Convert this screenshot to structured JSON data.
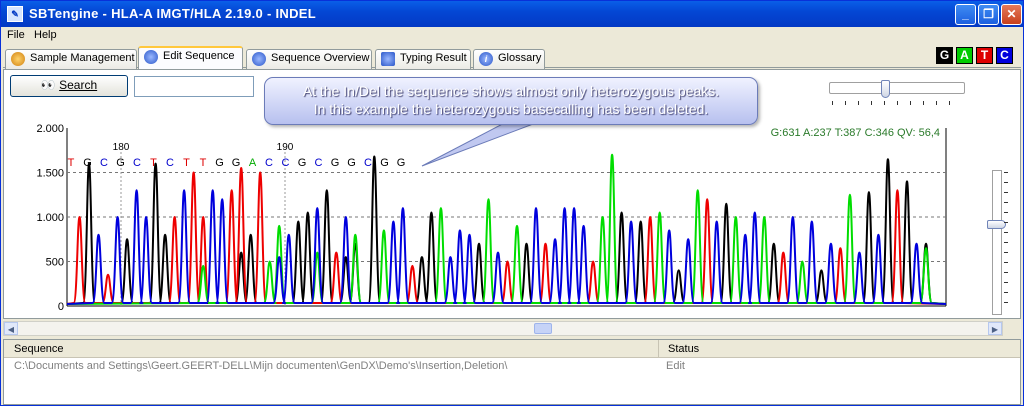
{
  "window": {
    "title": "SBTengine - HLA-A IMGT/HLA 2.19.0 - INDEL"
  },
  "menu": [
    "File",
    "Help"
  ],
  "tabs": [
    {
      "label": "Sample Management",
      "active": false,
      "icon": "sample-icon",
      "color": "#e8a020"
    },
    {
      "label": "Edit Sequence",
      "active": true,
      "icon": "edit-icon",
      "color": "#3060c8"
    },
    {
      "label": "Sequence Overview",
      "active": false,
      "icon": "overview-icon",
      "color": "#3060c8"
    },
    {
      "label": "Typing Result",
      "active": false,
      "icon": "typing-icon",
      "color": "#3060c8"
    },
    {
      "label": "Glossary",
      "active": false,
      "icon": "info-icon",
      "color": "#3060c8"
    }
  ],
  "base_buttons": [
    {
      "label": "G",
      "color": "#000000"
    },
    {
      "label": "A",
      "color": "#00cc00"
    },
    {
      "label": "T",
      "color": "#dd0000"
    },
    {
      "label": "C",
      "color": "#0000dd"
    }
  ],
  "search": {
    "button_label": "Search",
    "value": ""
  },
  "callout": {
    "line1": "At the In/Del the sequence shows almost only heterozygous peaks.",
    "line2": "In this example the heterozygous basecalling has been deleted."
  },
  "chart_data": {
    "type": "line",
    "y_ticks": [
      "2.000",
      "1.500",
      "1.000",
      "500",
      "0"
    ],
    "ylim": [
      0,
      2000
    ],
    "position_labels": [
      "180",
      "190"
    ],
    "bases": [
      "T",
      "G",
      "C",
      "G",
      "C",
      "T",
      "C",
      "T",
      "T",
      "G",
      "G",
      "A",
      "C",
      "C",
      "G",
      "C",
      "G",
      "G",
      "C",
      "G",
      "G"
    ],
    "base_colors": {
      "G": "#000000",
      "A": "#00aa00",
      "T": "#dd0000",
      "C": "#0000cc"
    },
    "stats": "G:631 A:237 T:387 C:346 QV: 56,4",
    "series_colors": {
      "black": "#000000",
      "red": "#ee0000",
      "green": "#00dd00",
      "blue": "#0000dd"
    },
    "peaks": {
      "red": [
        [
          1,
          1000
        ],
        [
          4,
          350
        ],
        [
          11,
          1000
        ],
        [
          13,
          1500
        ],
        [
          14,
          1000
        ],
        [
          17,
          1300
        ],
        [
          18,
          1550
        ],
        [
          20,
          1500
        ],
        [
          28,
          600
        ],
        [
          36,
          450
        ],
        [
          46,
          500
        ],
        [
          50,
          700
        ],
        [
          55,
          500
        ],
        [
          61,
          1000
        ],
        [
          67,
          1200
        ],
        [
          75,
          600
        ],
        [
          81,
          650
        ],
        [
          87,
          1300
        ]
      ],
      "black": [
        [
          2,
          1600
        ],
        [
          6,
          750
        ],
        [
          9,
          1600
        ],
        [
          10,
          800
        ],
        [
          18,
          600
        ],
        [
          19,
          800
        ],
        [
          24,
          950
        ],
        [
          25,
          1050
        ],
        [
          27,
          1300
        ],
        [
          29,
          550
        ],
        [
          30,
          700
        ],
        [
          32,
          1680
        ],
        [
          37,
          550
        ],
        [
          38,
          1050
        ],
        [
          43,
          700
        ],
        [
          48,
          700
        ],
        [
          58,
          1050
        ],
        [
          60,
          950
        ],
        [
          64,
          400
        ],
        [
          69,
          1150
        ],
        [
          74,
          700
        ],
        [
          79,
          400
        ],
        [
          84,
          1280
        ],
        [
          86,
          1650
        ],
        [
          88,
          1400
        ],
        [
          90,
          700
        ]
      ],
      "green": [
        [
          14,
          450
        ],
        [
          21,
          500
        ],
        [
          22,
          900
        ],
        [
          26,
          600
        ],
        [
          30,
          800
        ],
        [
          33,
          850
        ],
        [
          39,
          1100
        ],
        [
          44,
          1200
        ],
        [
          47,
          900
        ],
        [
          56,
          1000
        ],
        [
          57,
          1700
        ],
        [
          62,
          1050
        ],
        [
          66,
          1300
        ],
        [
          70,
          1000
        ],
        [
          73,
          1000
        ],
        [
          77,
          500
        ],
        [
          82,
          1250
        ],
        [
          90,
          650
        ]
      ],
      "blue": [
        [
          3,
          800
        ],
        [
          5,
          1000
        ],
        [
          7,
          1300
        ],
        [
          8,
          1000
        ],
        [
          12,
          1300
        ],
        [
          15,
          1300
        ],
        [
          16,
          1200
        ],
        [
          22,
          550
        ],
        [
          23,
          800
        ],
        [
          26,
          1100
        ],
        [
          29,
          1000
        ],
        [
          34,
          950
        ],
        [
          35,
          1100
        ],
        [
          40,
          550
        ],
        [
          41,
          850
        ],
        [
          42,
          800
        ],
        [
          45,
          600
        ],
        [
          49,
          1100
        ],
        [
          51,
          750
        ],
        [
          52,
          1100
        ],
        [
          53,
          1100
        ],
        [
          54,
          900
        ],
        [
          59,
          950
        ],
        [
          63,
          850
        ],
        [
          65,
          750
        ],
        [
          68,
          950
        ],
        [
          71,
          800
        ],
        [
          72,
          1050
        ],
        [
          76,
          1000
        ],
        [
          78,
          950
        ],
        [
          80,
          700
        ],
        [
          83,
          600
        ],
        [
          85,
          800
        ],
        [
          89,
          700
        ]
      ]
    }
  },
  "grid": {
    "headers": {
      "sequence": "Sequence",
      "status": "Status"
    },
    "rows": [
      {
        "sequence": "C:\\Documents and Settings\\Geert.GEERT-DELL\\Mijn documenten\\GenDX\\Demo's\\Insertion,Deletion\\",
        "status": "Edit"
      }
    ]
  }
}
